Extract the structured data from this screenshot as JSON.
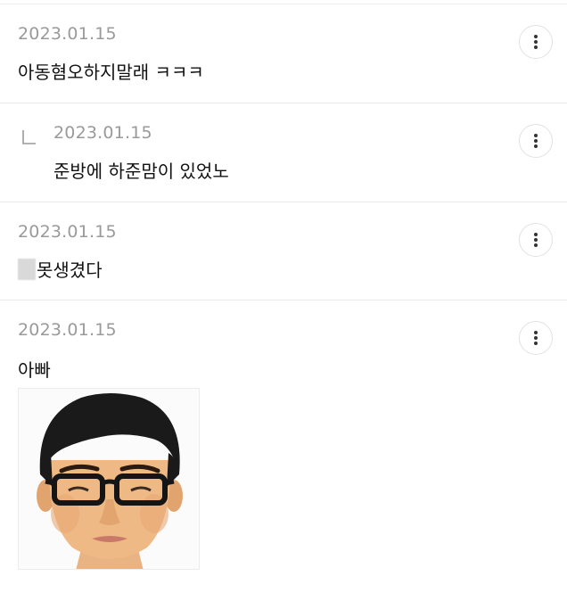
{
  "comments": [
    {
      "date": "2023.01.15",
      "text": "아동혐오하지말래 ㅋㅋㅋ",
      "more_icon": "more-vertical-icon"
    },
    {
      "date": "2023.01.15",
      "text": "준방에 하준맘이 있었노",
      "is_reply": true,
      "reply_icon": "reply-arrow-icon",
      "more_icon": "more-vertical-icon"
    },
    {
      "date": "2023.01.15",
      "text": "못생겼다",
      "more_icon": "more-vertical-icon"
    },
    {
      "date": "2023.01.15",
      "text": "아빠",
      "more_icon": "more-vertical-icon",
      "image": "cartoon-face-portrait"
    }
  ],
  "colors": {
    "date": "#9a9a9a",
    "text": "#111111",
    "divider": "#e9e9e9"
  }
}
